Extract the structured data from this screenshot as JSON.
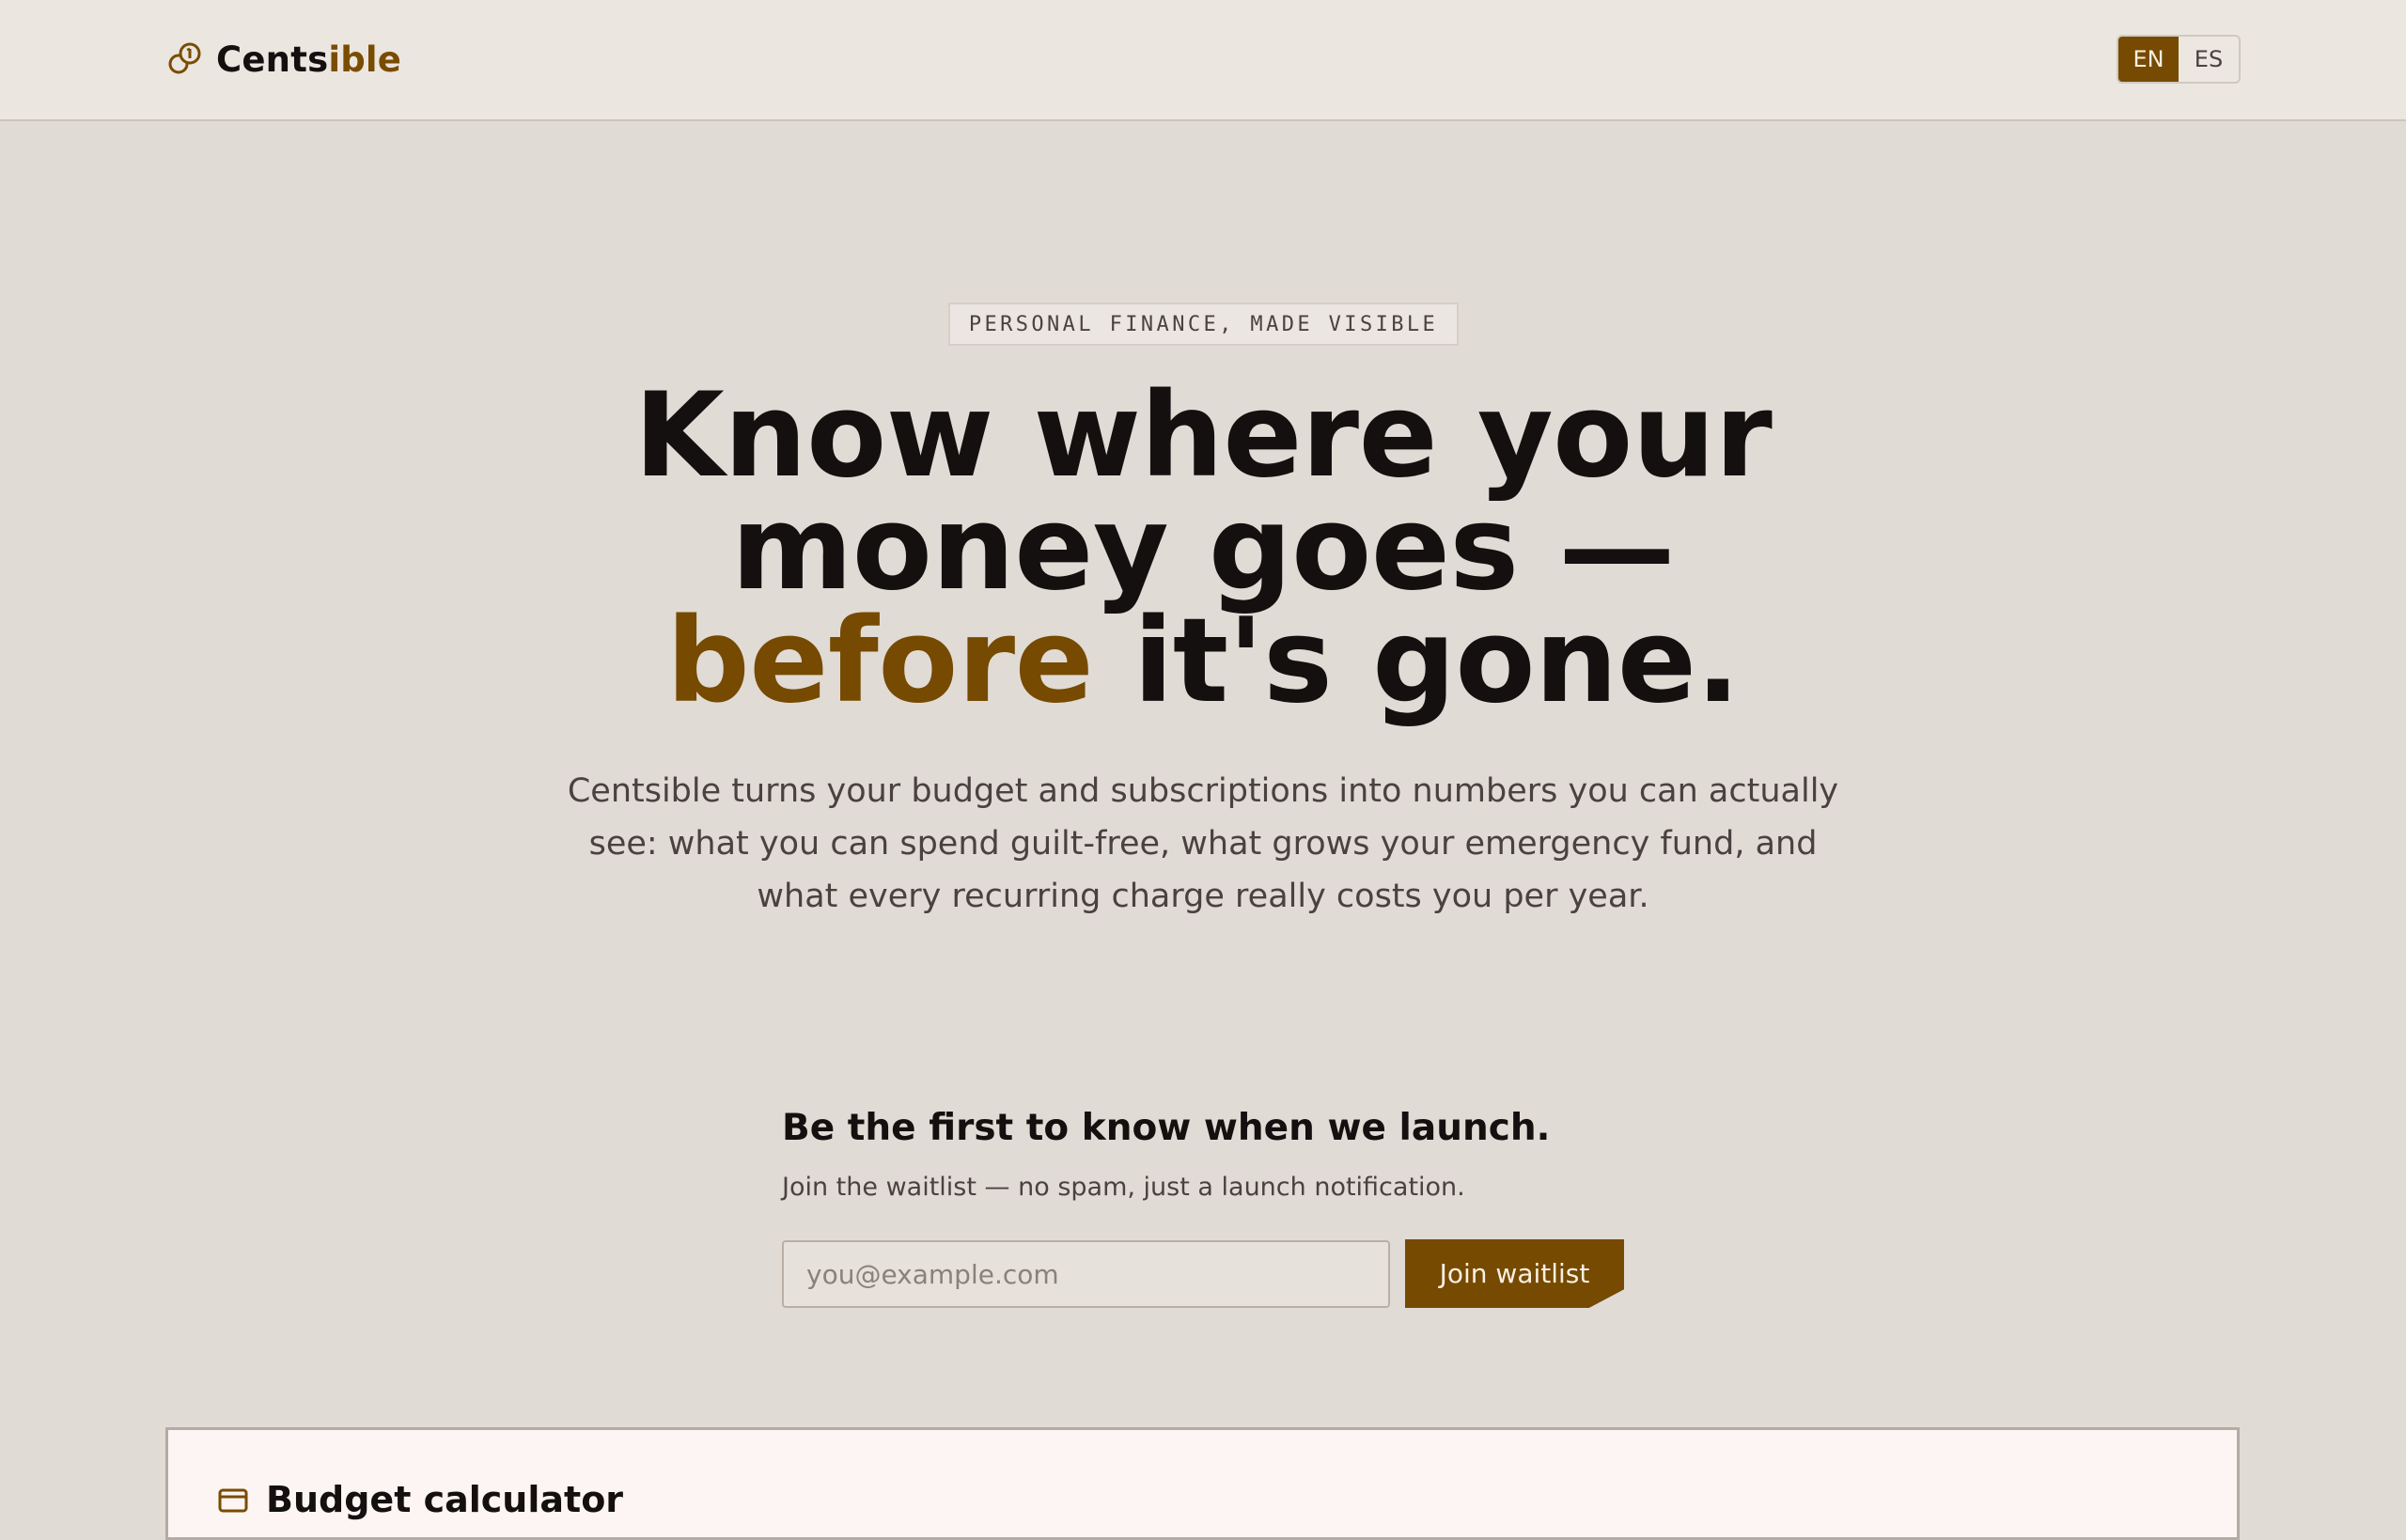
{
  "header": {
    "brand": {
      "name_part1": "Cents",
      "name_part2": "ible",
      "icon": "coins-icon"
    },
    "languages": [
      {
        "label": "EN",
        "active": true
      },
      {
        "label": "ES",
        "active": false
      }
    ]
  },
  "hero": {
    "eyebrow": "PERSONAL FINANCE, MADE VISIBLE",
    "title_line1": "Know where your",
    "title_line2": "money goes —",
    "title_accent": "before",
    "title_rest": " it's gone.",
    "subtitle": "Centsible turns your budget and subscriptions into numbers you can actually see: what you can spend guilt-free, what grows your emergency fund, and what every recurring charge really costs you per year."
  },
  "waitlist": {
    "title": "Be the first to know when we launch.",
    "subtitle": "Join the waitlist — no spam, just a launch notification.",
    "email_placeholder": "you@example.com",
    "email_value": "",
    "button_label": "Join waitlist"
  },
  "budget_card": {
    "icon": "wallet-icon",
    "title": "Budget calculator"
  },
  "colors": {
    "accent": "#764a00",
    "background": "#e1dbd5",
    "header_bg": "#ebe6e0",
    "text_dark": "#141010",
    "text_muted": "#4a4240"
  }
}
